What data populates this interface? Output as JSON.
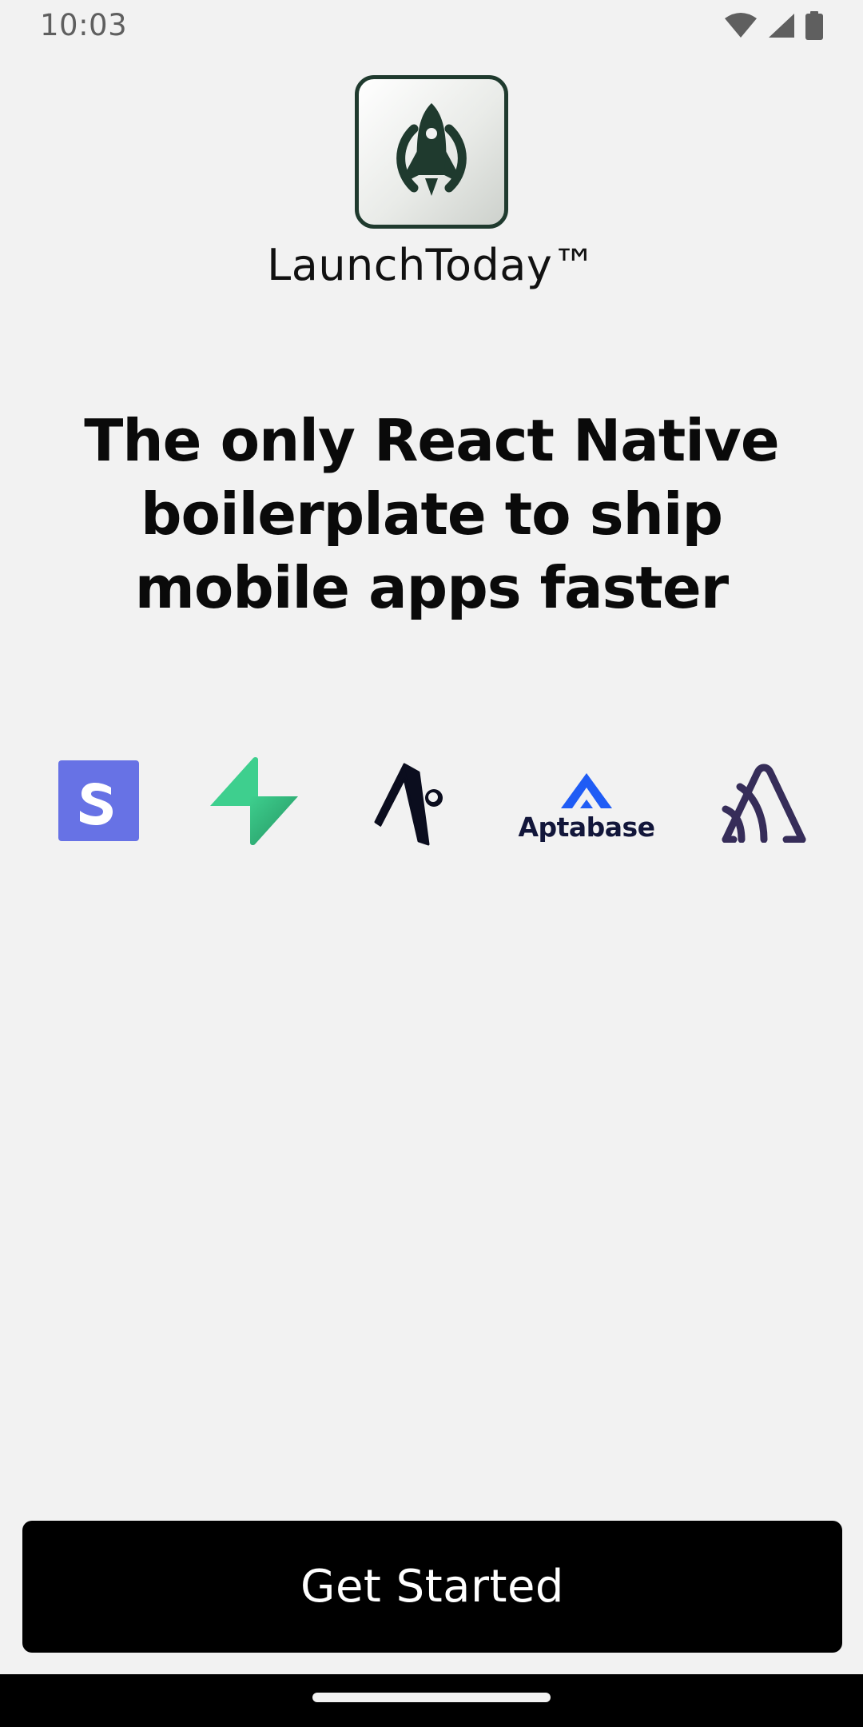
{
  "status_bar": {
    "time": "10:03",
    "icons": [
      "wifi-icon",
      "cellular-signal-icon",
      "battery-icon"
    ]
  },
  "app": {
    "logo_icon": "rocket-icon",
    "name": "LaunchToday™"
  },
  "headline": {
    "line1": "The only React Native",
    "line2": "boilerplate to ship",
    "line3": "mobile apps faster"
  },
  "tech_logos": {
    "items": [
      {
        "name": "stripe-logo",
        "color": "#6772e5"
      },
      {
        "name": "supabase-logo",
        "color": "#3ecf8e"
      },
      {
        "name": "expo-logo",
        "color": "#0b0d1e"
      },
      {
        "name": "aptabase-logo",
        "color": "#1f5cf5",
        "label": "Aptabase"
      },
      {
        "name": "sentry-logo",
        "color": "#362d59"
      }
    ]
  },
  "cta": {
    "label": "Get Started"
  },
  "colors": {
    "background": "#f2f2f2",
    "brand_green": "#1f3a2e",
    "button": "#000000",
    "button_text": "#ffffff"
  }
}
